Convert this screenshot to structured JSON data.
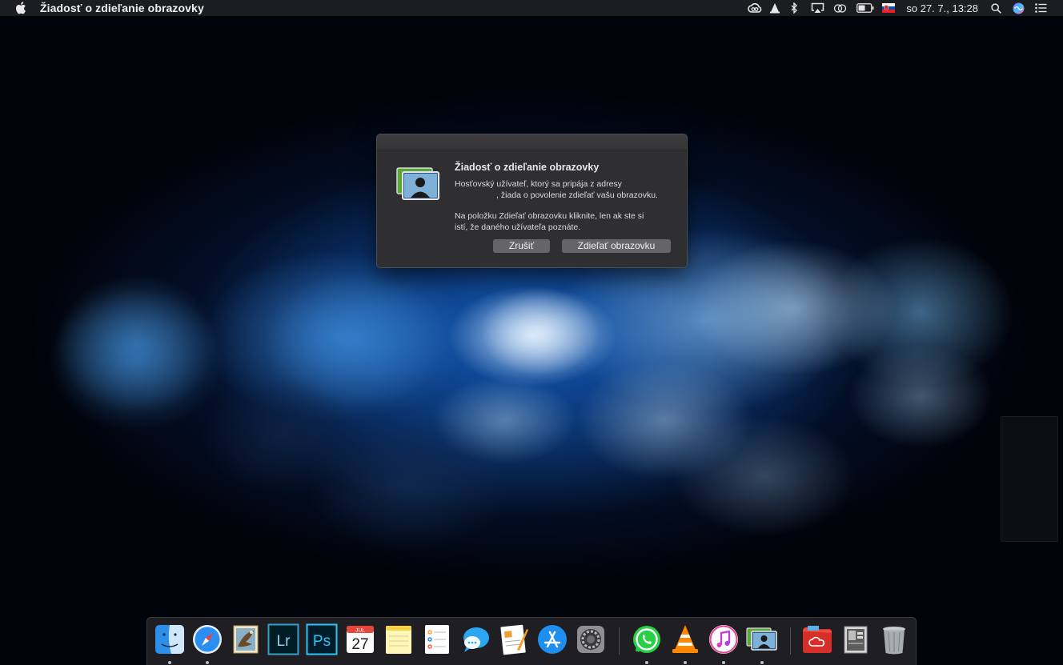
{
  "menubar": {
    "app_title": "Žiadosť o zdieľanie obrazovky",
    "datetime": "so 27. 7.,  13:28"
  },
  "dialog": {
    "title": "Žiadosť o zdieľanie obrazovky",
    "message_line1": "Hosťovský užívateľ, ktorý sa pripája z adresy",
    "message_line2": ", žiada o povolenie zdieľať vašu obrazovku.",
    "message_line3": "Na položku Zdieľať obrazovku kliknite, len ak ste si",
    "message_line4": "istí, že daného užívateľa poznáte.",
    "cancel_label": "Zrušiť",
    "share_label": "Zdieľať obrazovku"
  },
  "dock": {
    "lightroom_label": "Lr",
    "photoshop_label": "Ps",
    "calendar_month": "JUL",
    "calendar_day": "27",
    "items": [
      {
        "icon": "finder-icon",
        "running": true
      },
      {
        "icon": "safari-icon",
        "running": true
      },
      {
        "icon": "mail-icon",
        "running": false
      },
      {
        "icon": "lightroom-icon",
        "running": false
      },
      {
        "icon": "photoshop-icon",
        "running": false
      },
      {
        "icon": "calendar-icon",
        "running": false
      },
      {
        "icon": "notes-icon",
        "running": false
      },
      {
        "icon": "reminders-icon",
        "running": false
      },
      {
        "icon": "messages-icon",
        "running": false
      },
      {
        "icon": "pages-icon",
        "running": false
      },
      {
        "icon": "app-store-icon",
        "running": false
      },
      {
        "icon": "system-preferences-icon",
        "running": false
      },
      {
        "icon": "whatsapp-icon",
        "running": true
      },
      {
        "icon": "vlc-icon",
        "running": true
      },
      {
        "icon": "itunes-icon",
        "running": true
      },
      {
        "icon": "screen-sharing-icon",
        "running": true
      },
      {
        "icon": "creative-cloud-folder-icon",
        "running": false
      },
      {
        "icon": "downloads-stack-icon",
        "running": false
      },
      {
        "icon": "trash-icon",
        "running": false
      }
    ]
  },
  "colors": {
    "menubar_bg": "#1c1d20",
    "dialog_bg": "#2f2f31",
    "button_bg": "#656568",
    "wallpaper_accent": "#1e6fd0"
  }
}
